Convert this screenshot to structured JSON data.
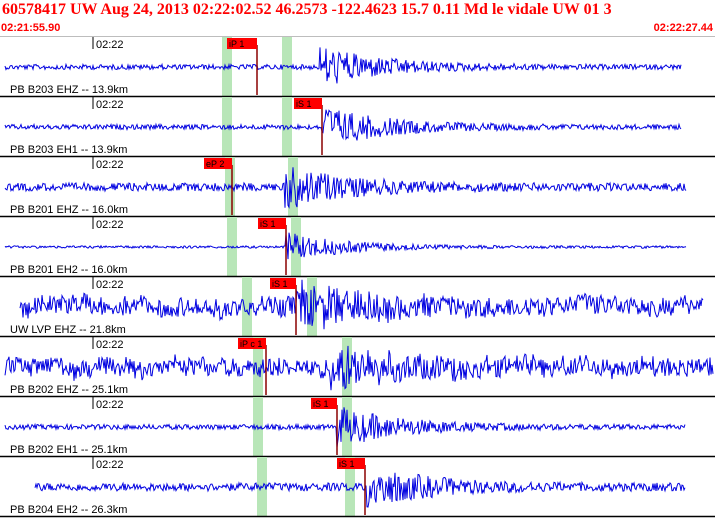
{
  "header": {
    "title": "60578417 UW Aug 24, 2013 02:22:02.52    46.2573 -122.4623 15.7 0.11 Md le vidale UW 01    3",
    "start_time": "02:21:55.90",
    "end_time": "02:22:27.44"
  },
  "colors": {
    "trace": "#0000e0",
    "pick_box": "#ff0000",
    "window_band": "#b8e6b8",
    "separator": "#000000",
    "header_text": "#ff0000"
  },
  "traces": [
    {
      "station": "PB B203 EHZ -- 13.9km",
      "time": "02:22",
      "pick": "iP 1",
      "amplitude": "low"
    },
    {
      "station": "PB B203 EH1 -- 13.9km",
      "time": "02:22",
      "pick": "iS 1",
      "amplitude": "low"
    },
    {
      "station": "PB B201 EHZ -- 16.0km",
      "time": "02:22",
      "pick": "eP 2",
      "amplitude": "medium"
    },
    {
      "station": "PB B201 EH2 -- 16.0km",
      "time": "02:22",
      "pick": "iS 1",
      "amplitude": "very-low"
    },
    {
      "station": "UW LVP EHZ -- 21.8km",
      "time": "02:22",
      "pick": "iS 1",
      "amplitude": "high"
    },
    {
      "station": "PB B202 EHZ -- 25.1km",
      "time": "02:22",
      "pick": "iP c 1",
      "amplitude": "high"
    },
    {
      "station": "PB B202 EH1 -- 25.1km",
      "time": "02:22",
      "pick": "iS 1",
      "amplitude": "low"
    },
    {
      "station": "PB B204 EH2 -- 26.3km",
      "time": "02:22",
      "pick": "iS 1",
      "amplitude": "medium"
    }
  ]
}
